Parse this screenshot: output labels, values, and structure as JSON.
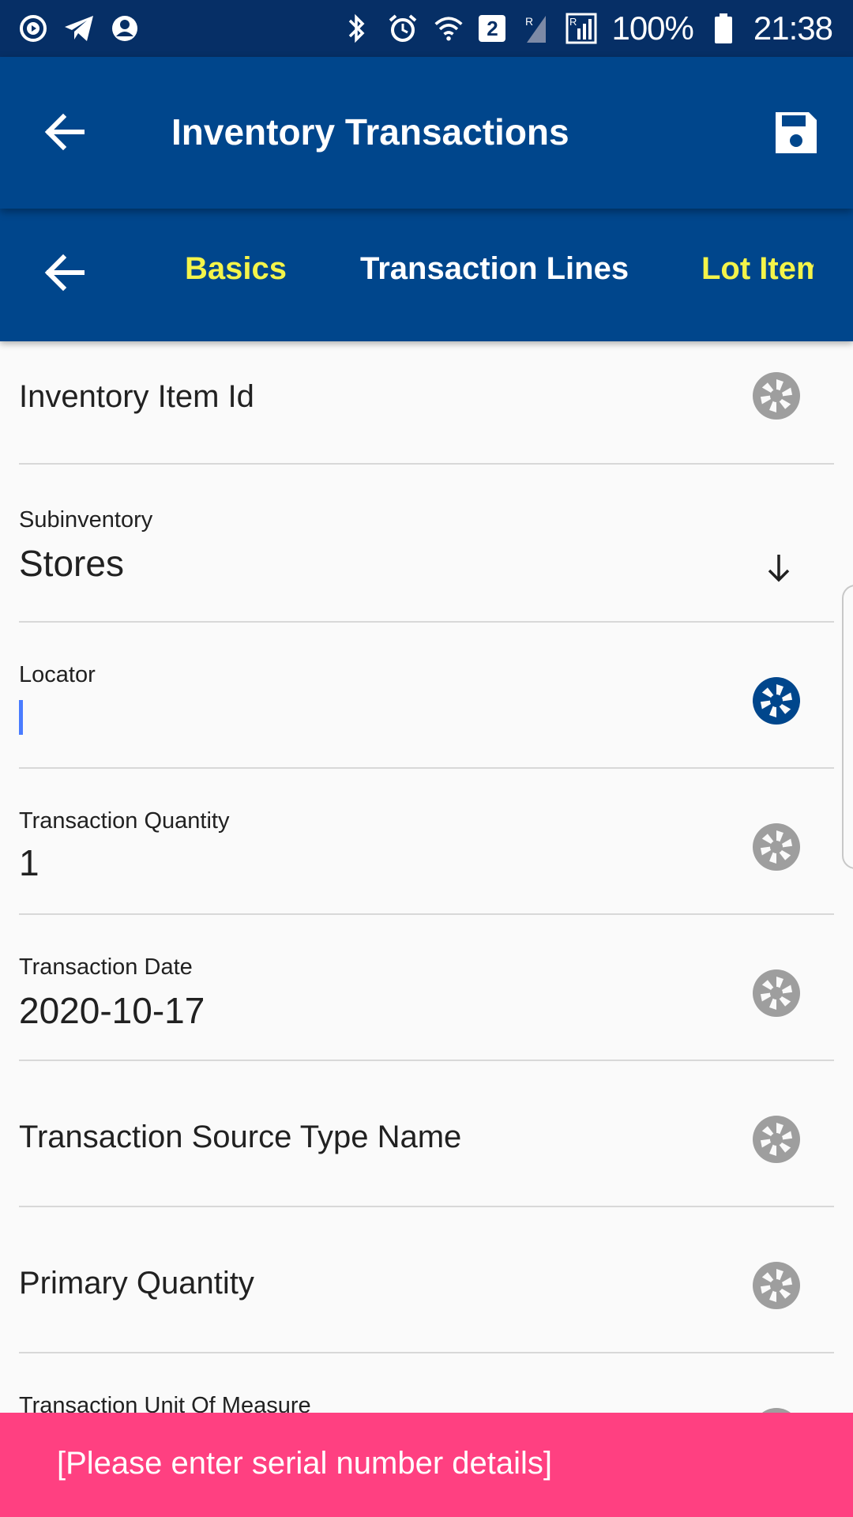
{
  "status_bar": {
    "left_icons": [
      "play-circle-icon",
      "telegram-icon",
      "account-circle-icon"
    ],
    "right_icons": [
      "bluetooth-icon",
      "alarm-icon",
      "wifi-icon",
      "sim-2-badge",
      "signal-roaming-icon",
      "signal-roaming-icon",
      "battery-icon"
    ],
    "sim_badge": "2",
    "battery": "100%",
    "time": "21:38"
  },
  "app_bar": {
    "title": "Inventory Transactions",
    "back_icon": "arrow-back-icon",
    "save_icon": "save-icon"
  },
  "tabs": {
    "back_icon": "arrow-back-icon",
    "items": [
      {
        "label": "Basics",
        "active": false
      },
      {
        "label": "Transaction Lines",
        "active": true
      },
      {
        "label": "Lot Item",
        "active": false
      }
    ]
  },
  "form": {
    "inventory_item_id": {
      "label": "Inventory Item Id",
      "value": ""
    },
    "subinventory": {
      "label": "Subinventory",
      "value": "Stores"
    },
    "locator": {
      "label": "Locator",
      "value": ""
    },
    "transaction_quantity": {
      "label": "Transaction Quantity",
      "value": "1"
    },
    "transaction_date": {
      "label": "Transaction Date",
      "value": "2020-10-17"
    },
    "transaction_source_type_name": {
      "label": "Transaction Source Type Name",
      "value": ""
    },
    "primary_quantity": {
      "label": "Primary Quantity",
      "value": ""
    },
    "transaction_unit_of_measure": {
      "label": "Transaction Unit Of Measure",
      "value": ""
    }
  },
  "snackbar": {
    "message": "[Please enter serial number details]"
  },
  "colors": {
    "status_bar": "#062f66",
    "app_bar": "#00468c",
    "tab_inactive": "#f4f44a",
    "tab_active": "#ffffff",
    "tab_indicator": "#3f51b5",
    "camera_inactive": "#9e9e9e",
    "camera_active": "#00468c",
    "snackbar": "#ff4081"
  }
}
